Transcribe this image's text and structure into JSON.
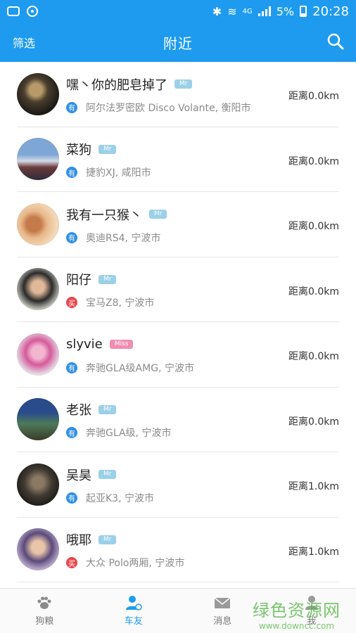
{
  "status_bar": {
    "network": "4G",
    "battery": "5%",
    "time": "20:28"
  },
  "app_bar": {
    "filter_label": "筛选",
    "title": "附近",
    "icons": [
      "search-icon"
    ]
  },
  "colors": {
    "brand": "#1e9bef",
    "badge_have": "#2f8fe8",
    "badge_buy": "#e8474c",
    "tag_mr": "#9bd0e8",
    "tag_miss": "#f08db0"
  },
  "nearby_users": [
    {
      "name": "嘿丶你的肥皂掉了",
      "tag": "Mr",
      "badge": "有",
      "car": "阿尔法罗密欧 Disco Volante, 衡阳市",
      "distance": "距离0.0km"
    },
    {
      "name": "菜狗",
      "tag": "Mr",
      "badge": "有",
      "car": "捷豹XJ, 咸阳市",
      "distance": "距离0.0km"
    },
    {
      "name": "我有一只猴丶",
      "tag": "Mr",
      "badge": "有",
      "car": "奥迪RS4, 宁波市",
      "distance": "距离0.0km"
    },
    {
      "name": "阳仔",
      "tag": "Mr",
      "badge": "买",
      "car": "宝马Z8, 宁波市",
      "distance": "距离0.0km"
    },
    {
      "name": "slyvie",
      "tag": "Miss",
      "badge": "有",
      "car": "奔驰GLA级AMG, 宁波市",
      "distance": "距离0.0km"
    },
    {
      "name": "老张",
      "tag": "Mr",
      "badge": "有",
      "car": "奔驰GLA级, 宁波市",
      "distance": "距离0.0km"
    },
    {
      "name": "吴昊",
      "tag": "Mr",
      "badge": "有",
      "car": "起亚K3, 宁波市",
      "distance": "距离1.0km"
    },
    {
      "name": "哦耶",
      "tag": "Mr",
      "badge": "买",
      "car": "大众 Polo两厢, 宁波市",
      "distance": "距离1.0km"
    }
  ],
  "tabbar": [
    {
      "label": "狗粮",
      "icon": "paw-icon",
      "active": false
    },
    {
      "label": "车友",
      "icon": "user-icon",
      "active": true
    },
    {
      "label": "消息",
      "icon": "mail-icon",
      "active": false
    },
    {
      "label": "我",
      "icon": "person-icon",
      "active": false
    }
  ],
  "watermark": {
    "main": "绿色资源网",
    "sub": "www.downcc.com"
  }
}
